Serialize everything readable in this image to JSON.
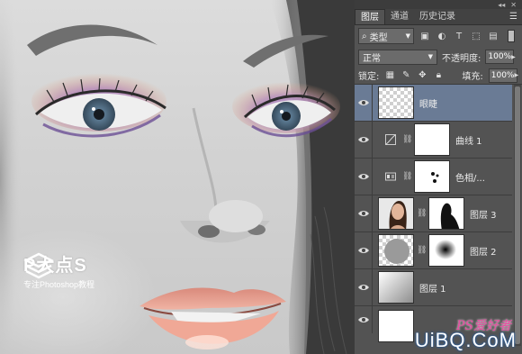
{
  "colors": {
    "panel_bg": "#535353",
    "selected_layer": "#6a7b95",
    "eyeshadow": "#8b6bb8",
    "lip": "#e39384"
  },
  "canvas_watermark": {
    "brand": "P大点S",
    "subtitle": "专注Photoshop教程",
    "logo_icon": "layers-stack-icon"
  },
  "panel": {
    "tabs": [
      {
        "label": "图层",
        "active": true
      },
      {
        "label": "通道",
        "active": false
      },
      {
        "label": "历史记录",
        "active": false
      }
    ],
    "filter": {
      "kind_label": "类型",
      "icons": [
        "image-icon",
        "adjustment-icon",
        "type-icon",
        "shape-icon",
        "smart-object-icon"
      ]
    },
    "blend_mode": "正常",
    "opacity_label": "不透明度:",
    "opacity_value": "100%",
    "lock_label": "锁定:",
    "lock_icons": [
      "lock-transparency-icon",
      "lock-paint-icon",
      "lock-move-icon",
      "lock-all-icon"
    ],
    "fill_label": "填充:",
    "fill_value": "100%",
    "layers": [
      {
        "name": "眼睫",
        "selected": true,
        "type": "pixel-transparent"
      },
      {
        "name": "曲线 1",
        "selected": false,
        "type": "curves-adjustment"
      },
      {
        "name": "色相/...",
        "selected": false,
        "type": "hue-saturation-adjustment"
      },
      {
        "name": "图层 3",
        "selected": false,
        "type": "pixel-with-mask"
      },
      {
        "name": "图层 2",
        "selected": false,
        "type": "pixel-with-mask"
      },
      {
        "name": "图层 1",
        "selected": false,
        "type": "gradient"
      },
      {
        "name": "",
        "selected": false,
        "type": "white"
      }
    ]
  },
  "site_watermark": {
    "text": "UiBQ.CoM",
    "ps_text": "PS爱好者"
  }
}
